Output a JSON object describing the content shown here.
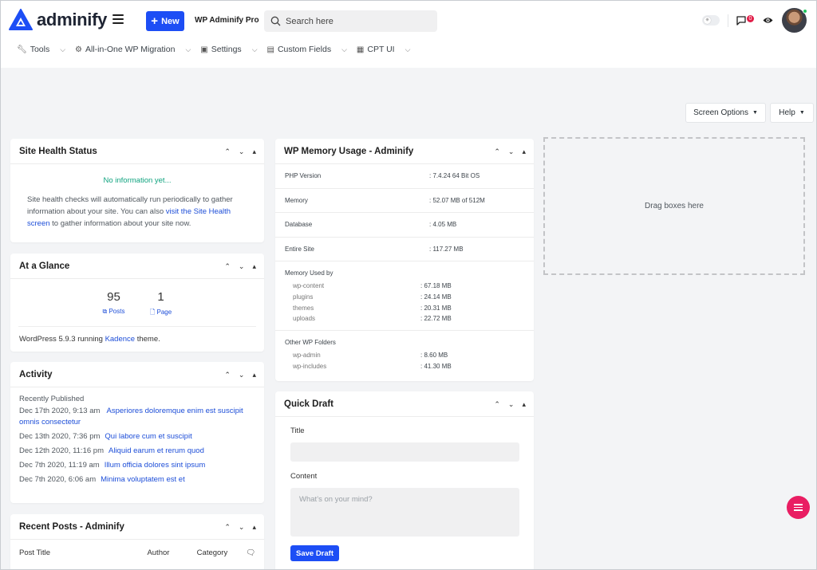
{
  "header": {
    "logo_text": "adminify",
    "new_button": "New",
    "site_name": "WP Adminify Pro",
    "search_placeholder": "Search here",
    "comments_count": "0"
  },
  "menubar": [
    {
      "label": "Tools",
      "icon": "wrench-icon"
    },
    {
      "label": "All-in-One WP Migration",
      "icon": "gear-icon"
    },
    {
      "label": "Settings",
      "icon": "settings-icon"
    },
    {
      "label": "Custom Fields",
      "icon": "table-icon"
    },
    {
      "label": "CPT UI",
      "icon": "cpt-icon"
    }
  ],
  "screen_options": {
    "screen_options_label": "Screen Options",
    "help_label": "Help"
  },
  "site_health": {
    "title": "Site Health Status",
    "no_info": "No information yet...",
    "text_before": "Site health checks will automatically run periodically to gather information about your site. You can also ",
    "link_text": "visit the Site Health screen",
    "text_after": " to gather information about your site now."
  },
  "at_a_glance": {
    "title": "At a Glance",
    "posts_count": "95",
    "posts_label": "Posts",
    "pages_count": "1",
    "pages_label": "Page",
    "wp_text_before": "WordPress 5.9.3 running ",
    "theme_link": "Kadence",
    "wp_text_after": " theme."
  },
  "activity": {
    "title": "Activity",
    "recent_label": "Recently Published",
    "items": [
      {
        "date": "Dec 17th 2020, 9:13 am",
        "title": "Asperiores doloremque enim est suscipit omnis consectetur"
      },
      {
        "date": "Dec 13th 2020, 7:36 pm",
        "title": "Qui labore cum et suscipit"
      },
      {
        "date": "Dec 12th 2020, 11:16 pm",
        "title": "Aliquid earum et rerum quod"
      },
      {
        "date": "Dec 7th 2020, 11:19 am",
        "title": "Illum officia dolores sint ipsum"
      },
      {
        "date": "Dec 7th 2020, 6:06 am",
        "title": "Minima voluptatem est et"
      }
    ]
  },
  "recent_posts": {
    "title": "Recent Posts - Adminify",
    "columns": [
      "Post Title",
      "Author",
      "Category"
    ]
  },
  "memory": {
    "title": "WP Memory Usage - Adminify",
    "rows": [
      {
        "label": "PHP Version",
        "value": ": 7.4.24 64 Bit OS"
      },
      {
        "label": "Memory",
        "value": ": 52.07 MB of 512M"
      },
      {
        "label": "Database",
        "value": ": 4.05 MB"
      },
      {
        "label": "Entire Site",
        "value": ": 117.27 MB"
      }
    ],
    "memory_used_title": "Memory Used by",
    "memory_used": [
      {
        "label": "wp-content",
        "value": ": 67.18 MB"
      },
      {
        "label": "plugins",
        "value": ": 24.14 MB"
      },
      {
        "label": "themes",
        "value": ": 20.31 MB"
      },
      {
        "label": "uploads",
        "value": ": 22.72 MB"
      }
    ],
    "other_title": "Other WP Folders",
    "other": [
      {
        "label": "wp-admin",
        "value": ": 8.60 MB"
      },
      {
        "label": "wp-includes",
        "value": ": 41.30 MB"
      }
    ]
  },
  "quick_draft": {
    "title": "Quick Draft",
    "title_label": "Title",
    "content_label": "Content",
    "content_placeholder": "What’s on your mind?",
    "save_button": "Save Draft"
  },
  "drop_zone": {
    "label": "Drag boxes here"
  },
  "colors": {
    "accent": "#1d4ef5",
    "fab": "#e91e63",
    "health_green": "#10a37f"
  }
}
